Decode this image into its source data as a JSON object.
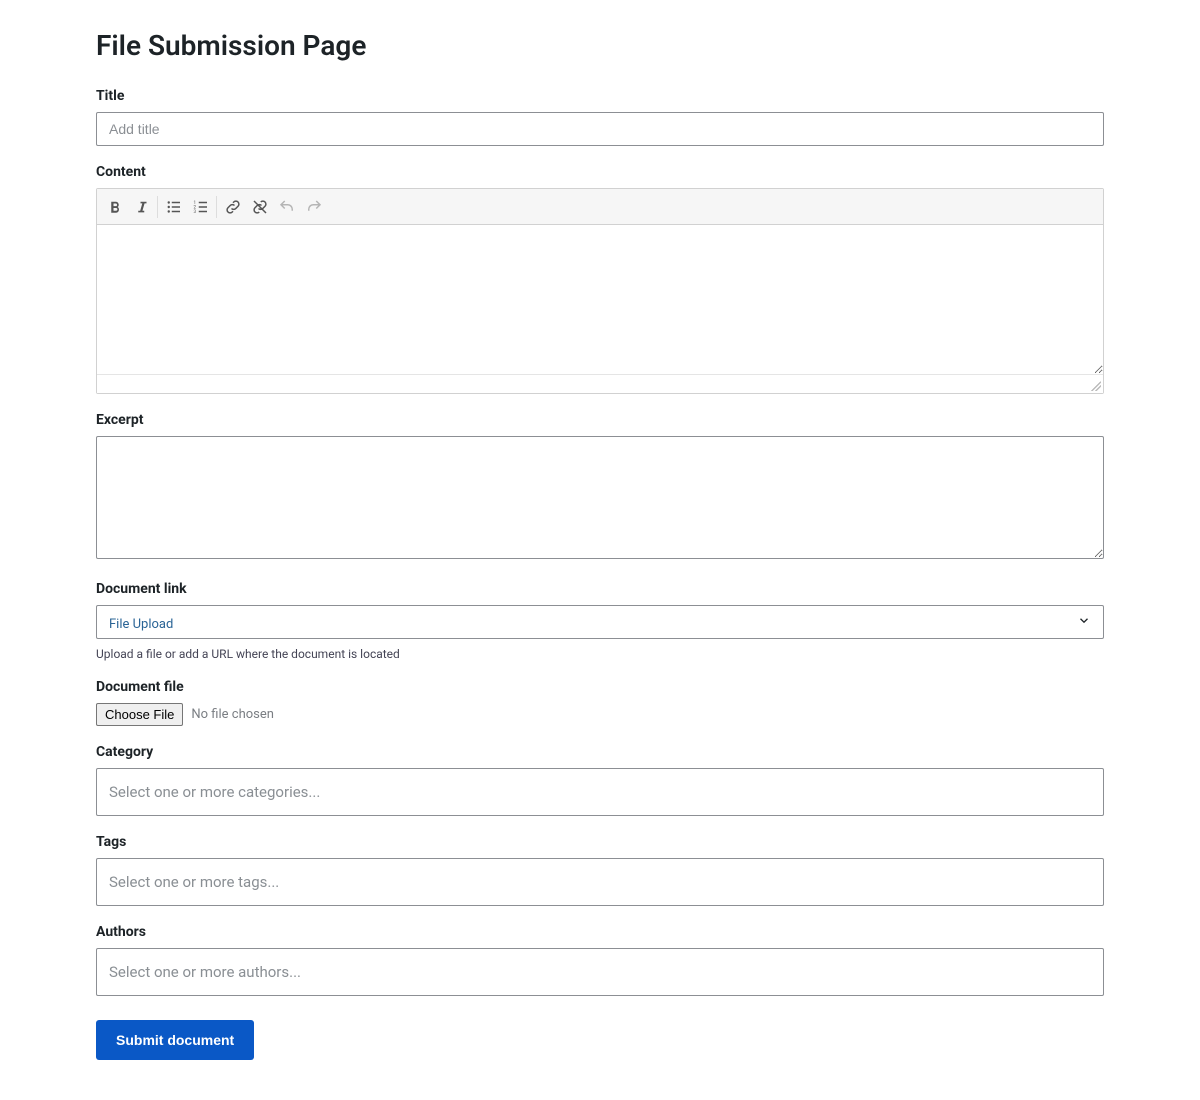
{
  "page": {
    "heading": "File Submission Page"
  },
  "fields": {
    "title": {
      "label": "Title",
      "placeholder": "Add title",
      "value": ""
    },
    "content": {
      "label": "Content",
      "value": ""
    },
    "excerpt": {
      "label": "Excerpt",
      "value": ""
    },
    "document_link": {
      "label": "Document link",
      "selected": "File Upload",
      "helper": "Upload a file or add a URL where the document is located"
    },
    "document_file": {
      "label": "Document file",
      "button": "Choose File",
      "status": "No file chosen"
    },
    "category": {
      "label": "Category",
      "placeholder": "Select one or more categories..."
    },
    "tags": {
      "label": "Tags",
      "placeholder": "Select one or more tags..."
    },
    "authors": {
      "label": "Authors",
      "placeholder": "Select one or more authors..."
    }
  },
  "editor_toolbar": {
    "bold": "bold-icon",
    "italic": "italic-icon",
    "ul": "bulleted-list-icon",
    "ol": "numbered-list-icon",
    "link": "link-icon",
    "unlink": "unlink-icon",
    "undo": "undo-icon",
    "redo": "redo-icon"
  },
  "actions": {
    "submit": "Submit document"
  }
}
